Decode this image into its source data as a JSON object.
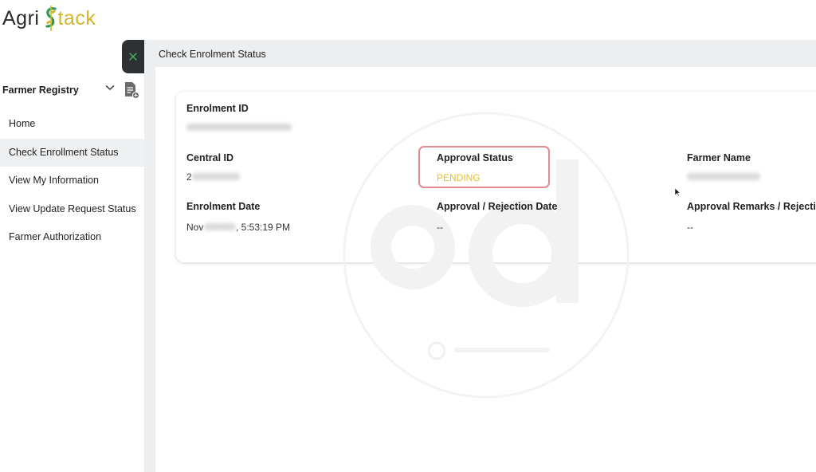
{
  "brand": {
    "part1": "Agri",
    "part2": "tack"
  },
  "sidebar": {
    "section_title": "Farmer Registry",
    "items": [
      {
        "label": "Home",
        "active": false
      },
      {
        "label": "Check Enrollment Status",
        "active": true
      },
      {
        "label": "View My Information",
        "active": false
      },
      {
        "label": "View Update Request Status",
        "active": false
      },
      {
        "label": "Farmer Authorization",
        "active": false
      }
    ]
  },
  "page": {
    "title": "Check Enrolment Status"
  },
  "status": {
    "enrolment_id_label": "Enrolment ID",
    "central_id_label": "Central ID",
    "central_id_visible": "2",
    "approval_status_label": "Approval Status",
    "approval_status_value": "PENDING",
    "farmer_name_label": "Farmer Name",
    "enrolment_date_label": "Enrolment Date",
    "enrolment_date_prefix": "Nov",
    "enrolment_date_suffix": ", 5:53:19 PM",
    "approval_date_label": "Approval / Rejection Date",
    "approval_date_value": "--",
    "remarks_label": "Approval Remarks / Rejection Rea",
    "remarks_value": "--"
  },
  "colors": {
    "accent_green": "#2e9a52",
    "logo_gold": "#d4b52a",
    "pending_yellow": "#e6c12a",
    "highlight_border": "#e48a95",
    "sidebar_close_bg": "#2d3133"
  },
  "icons": {
    "close": "close-icon",
    "chevron": "chevron-down-icon",
    "document": "document-plus-icon"
  }
}
